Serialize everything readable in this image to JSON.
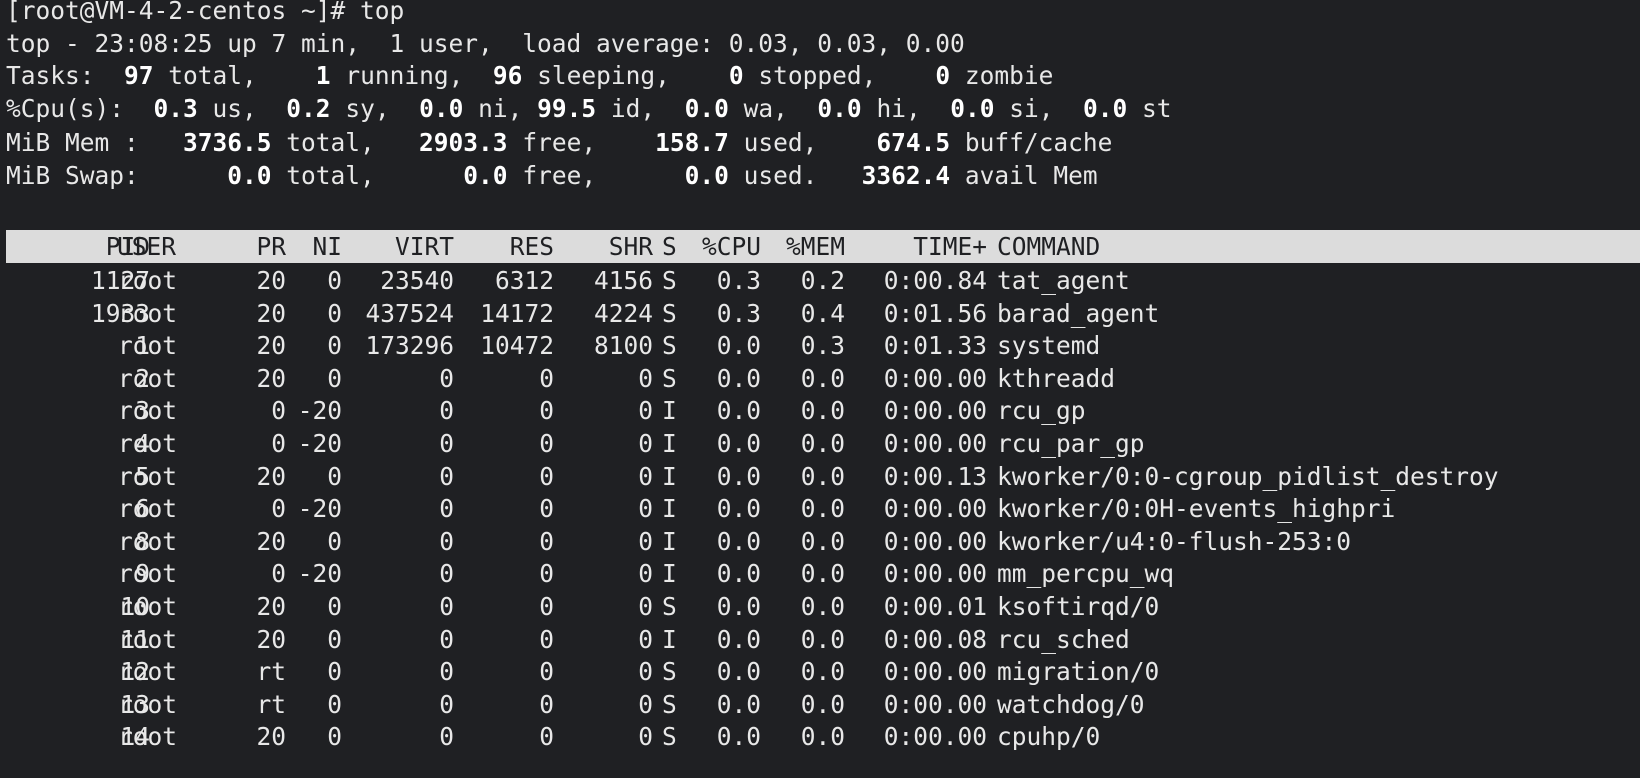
{
  "prompt": {
    "text": "[root@VM-4-2-centos ~]# top"
  },
  "summary": {
    "uptime": {
      "prefix": "top - 23:08:25 up 7 min,  1 user,  load average: 0.03, 0.03, 0.00"
    },
    "tasks": {
      "label": "Tasks: ",
      "total": " 97",
      "total_label": " total,   ",
      "running": " 1",
      "running_label": " running,  ",
      "sleeping": "96",
      "sleeping_label": " sleeping,   ",
      "stopped": " 0",
      "stopped_label": " stopped,   ",
      "zombie": " 0",
      "zombie_label": " zombie"
    },
    "cpu": {
      "label": "%Cpu(s):  ",
      "us": "0.3",
      "us_label": " us,  ",
      "sy": "0.2",
      "sy_label": " sy,  ",
      "ni": "0.0",
      "ni_label": " ni, ",
      "id": "99.5",
      "id_label": " id,  ",
      "wa": "0.0",
      "wa_label": " wa,  ",
      "hi": "0.0",
      "hi_label": " hi,  ",
      "si": "0.0",
      "si_label": " si,  ",
      "st": "0.0",
      "st_label": " st"
    },
    "mem": {
      "label": "MiB Mem :   ",
      "total": "3736.5",
      "total_label": " total,   ",
      "free": "2903.3",
      "free_label": " free,    ",
      "used": "158.7",
      "used_label": " used,    ",
      "buff": "674.5",
      "buff_label": " buff/cache"
    },
    "swap": {
      "label": "MiB Swap:      ",
      "total": "0.0",
      "total_label": " total,      ",
      "free": "0.0",
      "free_label": " free,      ",
      "used": "0.0",
      "used_label": " used.   ",
      "avail": "3362.4",
      "avail_label": " avail Mem"
    }
  },
  "table": {
    "headers": {
      "pid": "PID",
      "user": "USER",
      "pr": "PR",
      "ni": "NI",
      "virt": "VIRT",
      "res": "RES",
      "shr": "SHR",
      "s": "S",
      "cpu": "%CPU",
      "mem": "%MEM",
      "time": "TIME+",
      "command": "COMMAND"
    },
    "rows": [
      {
        "pid": "1127",
        "user": "root",
        "pr": "20",
        "ni": "0",
        "virt": "23540",
        "res": "6312",
        "shr": "4156",
        "s": "S",
        "cpu": "0.3",
        "mem": "0.2",
        "time": "0:00.84",
        "command": "tat_agent"
      },
      {
        "pid": "1933",
        "user": "root",
        "pr": "20",
        "ni": "0",
        "virt": "437524",
        "res": "14172",
        "shr": "4224",
        "s": "S",
        "cpu": "0.3",
        "mem": "0.4",
        "time": "0:01.56",
        "command": "barad_agent"
      },
      {
        "pid": "1",
        "user": "root",
        "pr": "20",
        "ni": "0",
        "virt": "173296",
        "res": "10472",
        "shr": "8100",
        "s": "S",
        "cpu": "0.0",
        "mem": "0.3",
        "time": "0:01.33",
        "command": "systemd"
      },
      {
        "pid": "2",
        "user": "root",
        "pr": "20",
        "ni": "0",
        "virt": "0",
        "res": "0",
        "shr": "0",
        "s": "S",
        "cpu": "0.0",
        "mem": "0.0",
        "time": "0:00.00",
        "command": "kthreadd"
      },
      {
        "pid": "3",
        "user": "root",
        "pr": "0",
        "ni": "-20",
        "virt": "0",
        "res": "0",
        "shr": "0",
        "s": "I",
        "cpu": "0.0",
        "mem": "0.0",
        "time": "0:00.00",
        "command": "rcu_gp"
      },
      {
        "pid": "4",
        "user": "root",
        "pr": "0",
        "ni": "-20",
        "virt": "0",
        "res": "0",
        "shr": "0",
        "s": "I",
        "cpu": "0.0",
        "mem": "0.0",
        "time": "0:00.00",
        "command": "rcu_par_gp"
      },
      {
        "pid": "5",
        "user": "root",
        "pr": "20",
        "ni": "0",
        "virt": "0",
        "res": "0",
        "shr": "0",
        "s": "I",
        "cpu": "0.0",
        "mem": "0.0",
        "time": "0:00.13",
        "command": "kworker/0:0-cgroup_pidlist_destroy"
      },
      {
        "pid": "6",
        "user": "root",
        "pr": "0",
        "ni": "-20",
        "virt": "0",
        "res": "0",
        "shr": "0",
        "s": "I",
        "cpu": "0.0",
        "mem": "0.0",
        "time": "0:00.00",
        "command": "kworker/0:0H-events_highpri"
      },
      {
        "pid": "8",
        "user": "root",
        "pr": "20",
        "ni": "0",
        "virt": "0",
        "res": "0",
        "shr": "0",
        "s": "I",
        "cpu": "0.0",
        "mem": "0.0",
        "time": "0:00.00",
        "command": "kworker/u4:0-flush-253:0"
      },
      {
        "pid": "9",
        "user": "root",
        "pr": "0",
        "ni": "-20",
        "virt": "0",
        "res": "0",
        "shr": "0",
        "s": "I",
        "cpu": "0.0",
        "mem": "0.0",
        "time": "0:00.00",
        "command": "mm_percpu_wq"
      },
      {
        "pid": "10",
        "user": "root",
        "pr": "20",
        "ni": "0",
        "virt": "0",
        "res": "0",
        "shr": "0",
        "s": "S",
        "cpu": "0.0",
        "mem": "0.0",
        "time": "0:00.01",
        "command": "ksoftirqd/0"
      },
      {
        "pid": "11",
        "user": "root",
        "pr": "20",
        "ni": "0",
        "virt": "0",
        "res": "0",
        "shr": "0",
        "s": "I",
        "cpu": "0.0",
        "mem": "0.0",
        "time": "0:00.08",
        "command": "rcu_sched"
      },
      {
        "pid": "12",
        "user": "root",
        "pr": "rt",
        "ni": "0",
        "virt": "0",
        "res": "0",
        "shr": "0",
        "s": "S",
        "cpu": "0.0",
        "mem": "0.0",
        "time": "0:00.00",
        "command": "migration/0"
      },
      {
        "pid": "13",
        "user": "root",
        "pr": "rt",
        "ni": "0",
        "virt": "0",
        "res": "0",
        "shr": "0",
        "s": "S",
        "cpu": "0.0",
        "mem": "0.0",
        "time": "0:00.00",
        "command": "watchdog/0"
      },
      {
        "pid": "14",
        "user": "root",
        "pr": "20",
        "ni": "0",
        "virt": "0",
        "res": "0",
        "shr": "0",
        "s": "S",
        "cpu": "0.0",
        "mem": "0.0",
        "time": "0:00.00",
        "command": "cpuhp/0"
      }
    ]
  },
  "colors": {
    "background": "#1f2023",
    "foreground": "#e8e8e8",
    "header_bar_bg": "#dcdcdc",
    "header_bar_fg": "#1f2023"
  }
}
